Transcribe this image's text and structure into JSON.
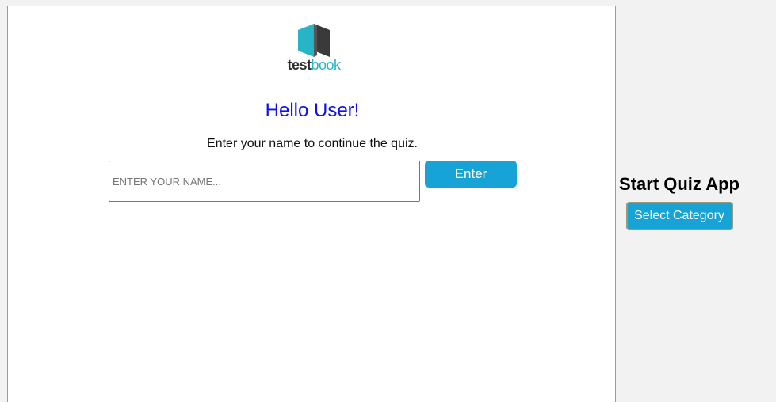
{
  "logo": {
    "text_part1": "test",
    "text_part2": "book",
    "icon": "book-logo-icon",
    "colors": {
      "dark": "#2d2d2d",
      "accent": "#27b4c7"
    }
  },
  "main": {
    "greeting": "Hello User!",
    "instructions": "Enter your name to continue the quiz.",
    "name_placeholder": "ENTER YOUR NAME...",
    "name_value": "",
    "enter_label": "Enter"
  },
  "side": {
    "title": "Start Quiz App",
    "select_category_label": "Select Category"
  },
  "colors": {
    "button": "#17a3d6",
    "greeting": "#1010ee",
    "background": "#f2f2f2",
    "panel": "#ffffff"
  }
}
